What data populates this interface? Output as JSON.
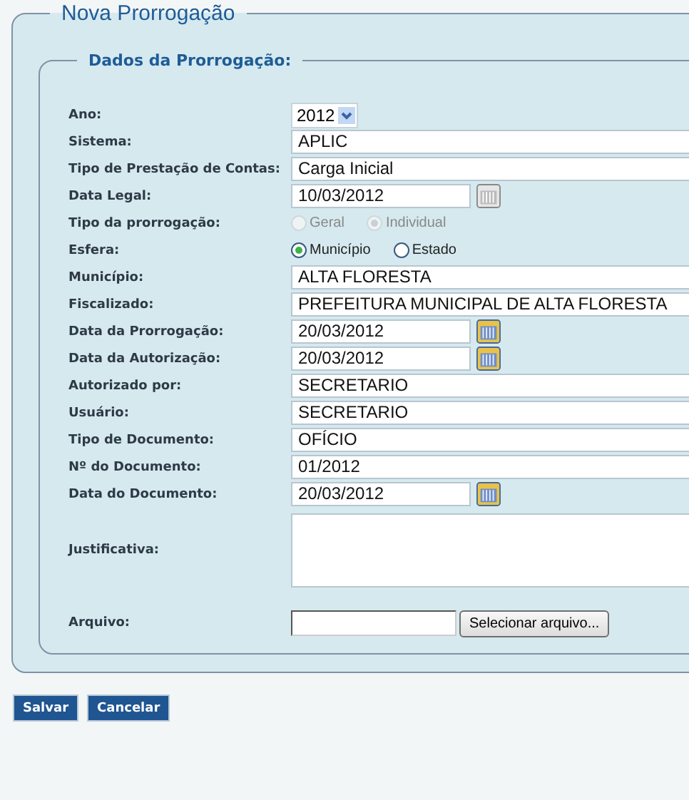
{
  "title": "Nova Prorrogação",
  "section": {
    "title": "Dados da Prorrogação:",
    "rows": [
      {
        "kind": "select",
        "label": "Ano:",
        "value": "2012"
      },
      {
        "kind": "text",
        "label": "Sistema:",
        "value": "APLIC"
      },
      {
        "kind": "text",
        "label": "Tipo de Prestação de Contas:",
        "value": "Carga Inicial"
      },
      {
        "kind": "date",
        "label": "Data Legal:",
        "value": "10/03/2012",
        "disabled": true
      },
      {
        "kind": "radio",
        "label": "Tipo da prorrogação:",
        "disabled": true,
        "options": [
          {
            "label": "Geral",
            "selected": false
          },
          {
            "label": "Individual",
            "selected": true
          }
        ]
      },
      {
        "kind": "radio",
        "label": "Esfera:",
        "disabled": false,
        "options": [
          {
            "label": "Município",
            "selected": true
          },
          {
            "label": "Estado",
            "selected": false
          }
        ]
      },
      {
        "kind": "text",
        "label": "Município:",
        "value": "ALTA FLORESTA"
      },
      {
        "kind": "text",
        "label": "Fiscalizado:",
        "value": "PREFEITURA MUNICIPAL DE ALTA FLORESTA"
      },
      {
        "kind": "date",
        "label": "Data da Prorrogação:",
        "value": "20/03/2012",
        "disabled": false
      },
      {
        "kind": "date",
        "label": "Data da Autorização:",
        "value": "20/03/2012",
        "disabled": false
      },
      {
        "kind": "text",
        "label": "Autorizado por:",
        "value": "SECRETARIO"
      },
      {
        "kind": "text",
        "label": "Usuário:",
        "value": "SECRETARIO"
      },
      {
        "kind": "text",
        "label": "Tipo de Documento:",
        "value": "OFÍCIO"
      },
      {
        "kind": "text",
        "label": "Nº do Documento:",
        "value": "01/2012"
      },
      {
        "kind": "date",
        "label": "Data do Documento:",
        "value": "20/03/2012",
        "disabled": false
      },
      {
        "kind": "textarea",
        "label": "Justificativa:"
      },
      {
        "kind": "file",
        "label": "Arquivo:",
        "button": "Selecionar arquivo..."
      }
    ]
  },
  "buttons": [
    "Salvar",
    "Cancelar"
  ]
}
